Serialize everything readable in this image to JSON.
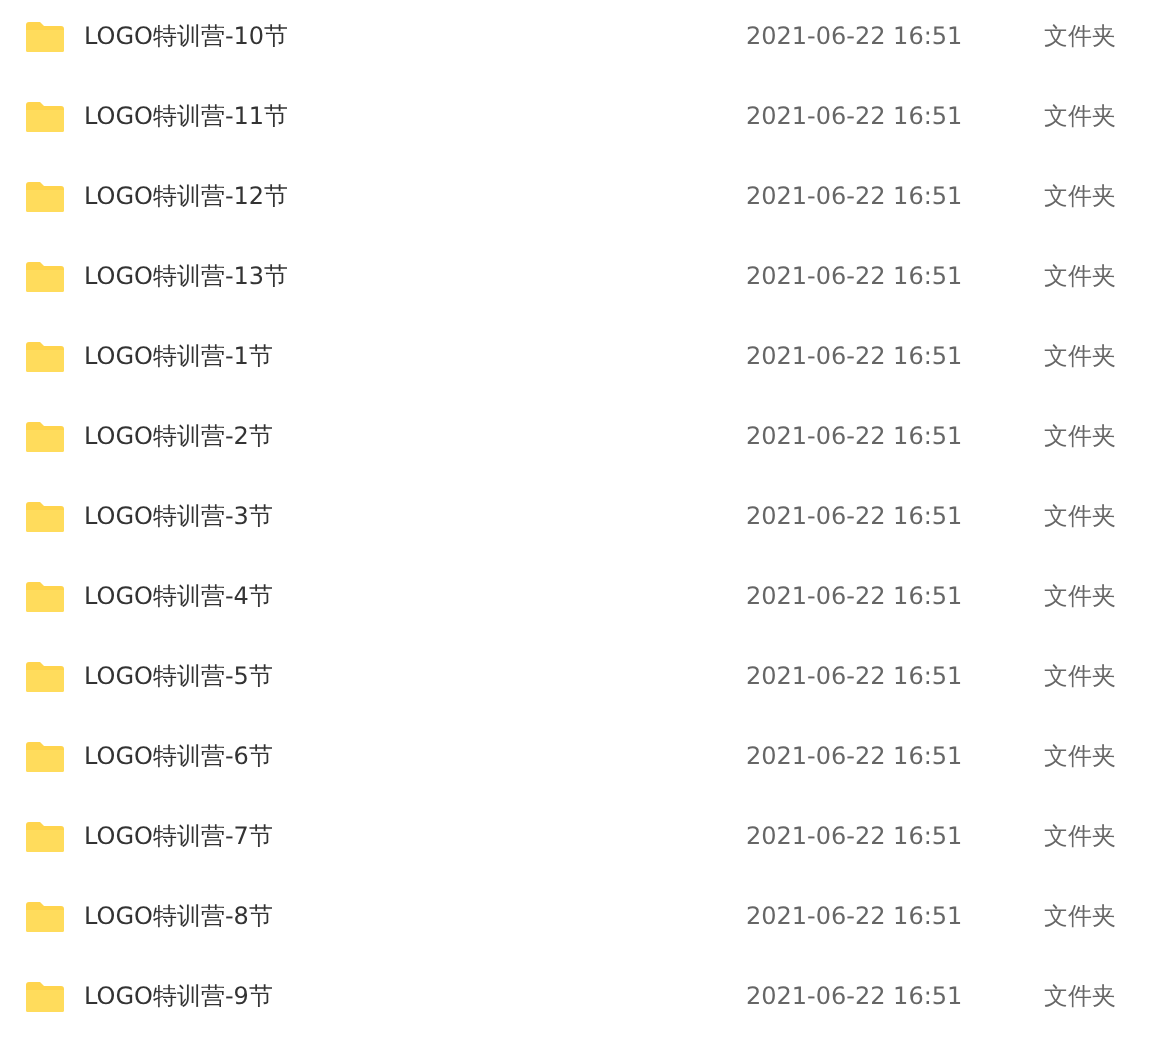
{
  "files": [
    {
      "name": "LOGO特训营-10节",
      "modified": "2021-06-22 16:51",
      "type": "文件夹"
    },
    {
      "name": "LOGO特训营-11节",
      "modified": "2021-06-22 16:51",
      "type": "文件夹"
    },
    {
      "name": "LOGO特训营-12节",
      "modified": "2021-06-22 16:51",
      "type": "文件夹"
    },
    {
      "name": "LOGO特训营-13节",
      "modified": "2021-06-22 16:51",
      "type": "文件夹"
    },
    {
      "name": "LOGO特训营-1节",
      "modified": "2021-06-22 16:51",
      "type": "文件夹"
    },
    {
      "name": "LOGO特训营-2节",
      "modified": "2021-06-22 16:51",
      "type": "文件夹"
    },
    {
      "name": "LOGO特训营-3节",
      "modified": "2021-06-22 16:51",
      "type": "文件夹"
    },
    {
      "name": "LOGO特训营-4节",
      "modified": "2021-06-22 16:51",
      "type": "文件夹"
    },
    {
      "name": "LOGO特训营-5节",
      "modified": "2021-06-22 16:51",
      "type": "文件夹"
    },
    {
      "name": "LOGO特训营-6节",
      "modified": "2021-06-22 16:51",
      "type": "文件夹"
    },
    {
      "name": "LOGO特训营-7节",
      "modified": "2021-06-22 16:51",
      "type": "文件夹"
    },
    {
      "name": "LOGO特训营-8节",
      "modified": "2021-06-22 16:51",
      "type": "文件夹"
    },
    {
      "name": "LOGO特训营-9节",
      "modified": "2021-06-22 16:51",
      "type": "文件夹"
    }
  ]
}
